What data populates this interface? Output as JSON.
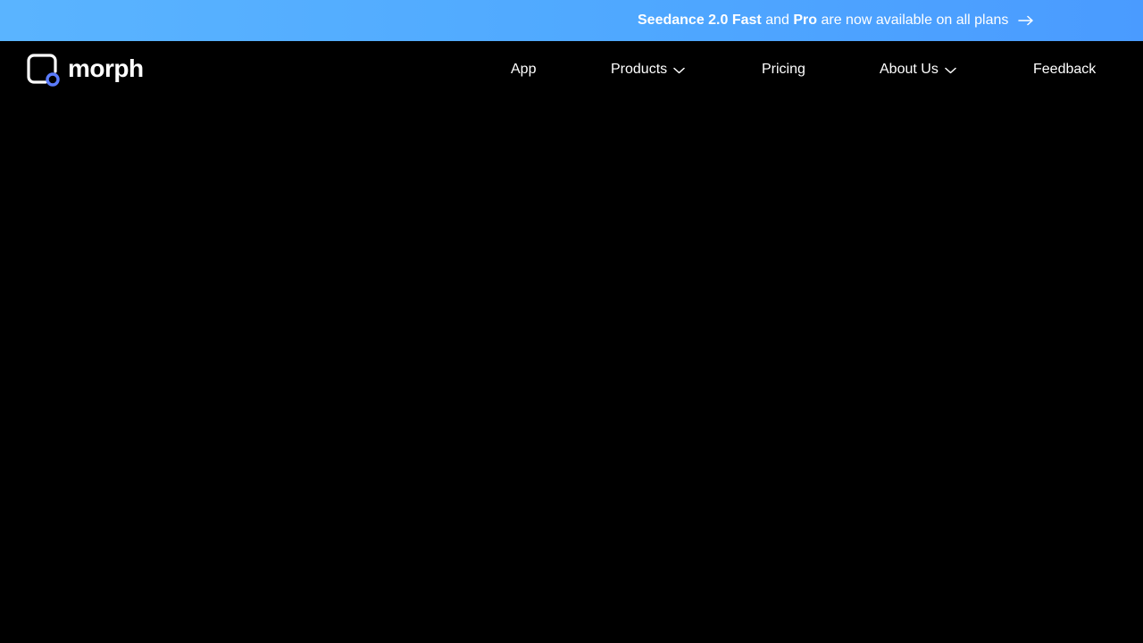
{
  "banner": {
    "part1": "Seedance 2.0 Fast",
    "part2": "and",
    "part3": "Pro",
    "part4": "are now available on all plans",
    "arrow_icon": "arrow-right-icon",
    "gradient_start": "#5ab4ff",
    "gradient_end": "#4a9bff"
  },
  "nav": {
    "logo_text": "morph",
    "items": [
      {
        "label": "App"
      },
      {
        "label": "Products",
        "icon": "chevron-down-icon"
      },
      {
        "label": "Pricing"
      },
      {
        "label": "About Us",
        "icon": "chevron-down-icon"
      },
      {
        "label": "Feedback"
      }
    ]
  },
  "colors": {
    "background": "#000000",
    "text": "#ffffff",
    "logo_accent": "#5b7cff"
  }
}
